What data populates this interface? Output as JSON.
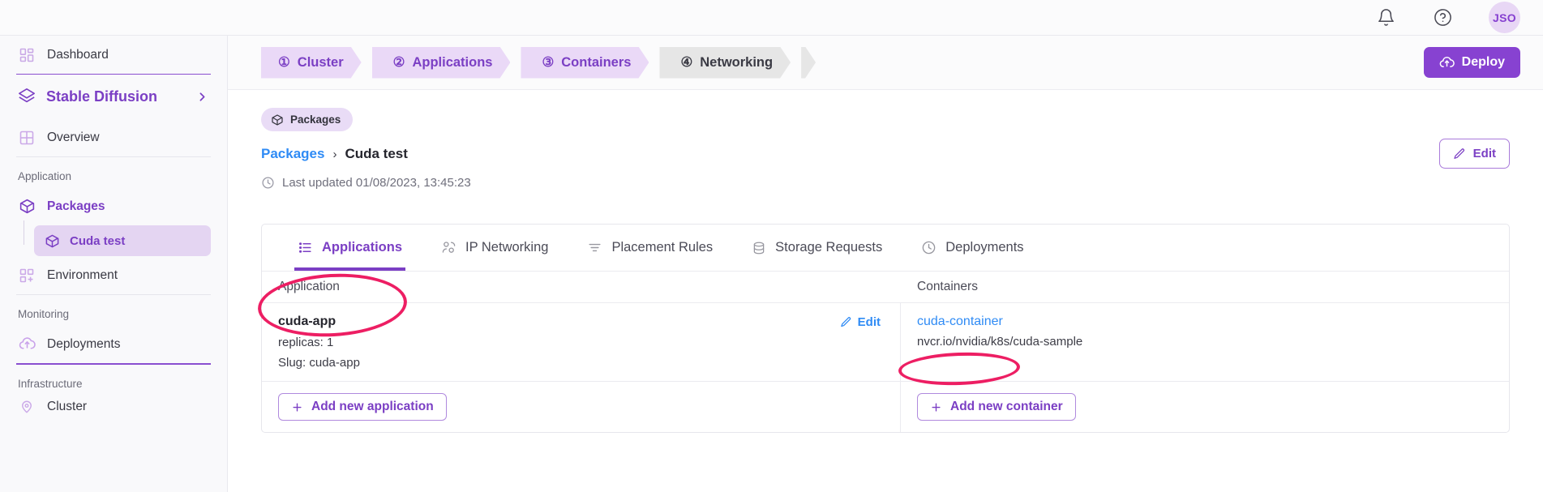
{
  "topbar": {
    "notifications_icon": "bell-icon",
    "help_icon": "question-circle-icon",
    "avatar_initials": "JSO"
  },
  "sidebar": {
    "dashboard": {
      "label": "Dashboard",
      "icon": "grid-icon"
    },
    "project": {
      "label": "Stable Diffusion",
      "icon": "layers-icon",
      "chevron": "chevron-right-icon"
    },
    "overview": {
      "label": "Overview",
      "icon": "window-grid-icon"
    },
    "groups": [
      {
        "label": "Application"
      },
      {
        "label": "Monitoring"
      },
      {
        "label": "Infrastructure"
      }
    ],
    "packages": {
      "label": "Packages",
      "icon": "package-icon"
    },
    "active_child": {
      "label": "Cuda test",
      "icon": "package-icon"
    },
    "environment": {
      "label": "Environment",
      "icon": "grid-plus-icon"
    },
    "deployments": {
      "label": "Deployments",
      "icon": "cloud-upload-icon"
    },
    "cluster_partial": {
      "label": "Cluster",
      "icon": "pin-icon"
    }
  },
  "stepper": {
    "steps": [
      {
        "num": "①",
        "label": "Cluster",
        "state": "done"
      },
      {
        "num": "②",
        "label": "Applications",
        "state": "done"
      },
      {
        "num": "③",
        "label": "Containers",
        "state": "done"
      },
      {
        "num": "④",
        "label": "Networking",
        "state": "current"
      }
    ]
  },
  "deploy_button": {
    "label": "Deploy",
    "icon": "cloud-upload-icon"
  },
  "page": {
    "chip": {
      "label": "Packages",
      "icon": "package-icon"
    },
    "breadcrumb": {
      "root": "Packages",
      "separator": "›",
      "current": "Cuda test"
    },
    "last_updated": {
      "icon": "clock-icon",
      "text": "Last updated 01/08/2023, 13:45:23"
    },
    "edit_button": {
      "label": "Edit",
      "icon": "pencil-icon"
    }
  },
  "tabs": [
    {
      "label": "Applications",
      "icon": "list-icon",
      "active": true
    },
    {
      "label": "IP Networking",
      "icon": "network-nodes-icon",
      "active": false
    },
    {
      "label": "Placement Rules",
      "icon": "filter-lines-icon",
      "active": false
    },
    {
      "label": "Storage Requests",
      "icon": "database-icon",
      "active": false
    },
    {
      "label": "Deployments",
      "icon": "clock-icon",
      "active": false
    }
  ],
  "table": {
    "headers": {
      "application": "Application",
      "containers": "Containers"
    },
    "rows": [
      {
        "app_name": "cuda-app",
        "app_replicas": "replicas: 1",
        "app_slug": "Slug: cuda-app",
        "row_edit_label": "Edit",
        "row_edit_icon": "pencil-icon",
        "container_name": "cuda-container",
        "container_image": "nvcr.io/nvidia/k8s/cuda-sample"
      }
    ],
    "add_application_button": {
      "label": "Add new application",
      "icon": "plus-icon"
    },
    "add_container_button": {
      "label": "Add new container",
      "icon": "plus-icon"
    }
  },
  "colors": {
    "brand_purple": "#7b3fc4",
    "deploy_purple": "#8742d1",
    "link_blue": "#2f8bf5",
    "annotation_pink": "#ed1e63",
    "step_active_bg": "#ead9f7",
    "step_inactive_bg": "#e6e6e6",
    "sidebar_bg": "#f9f9fb"
  },
  "annotations": [
    {
      "target": "tab-applications"
    },
    {
      "target": "container-link"
    }
  ]
}
